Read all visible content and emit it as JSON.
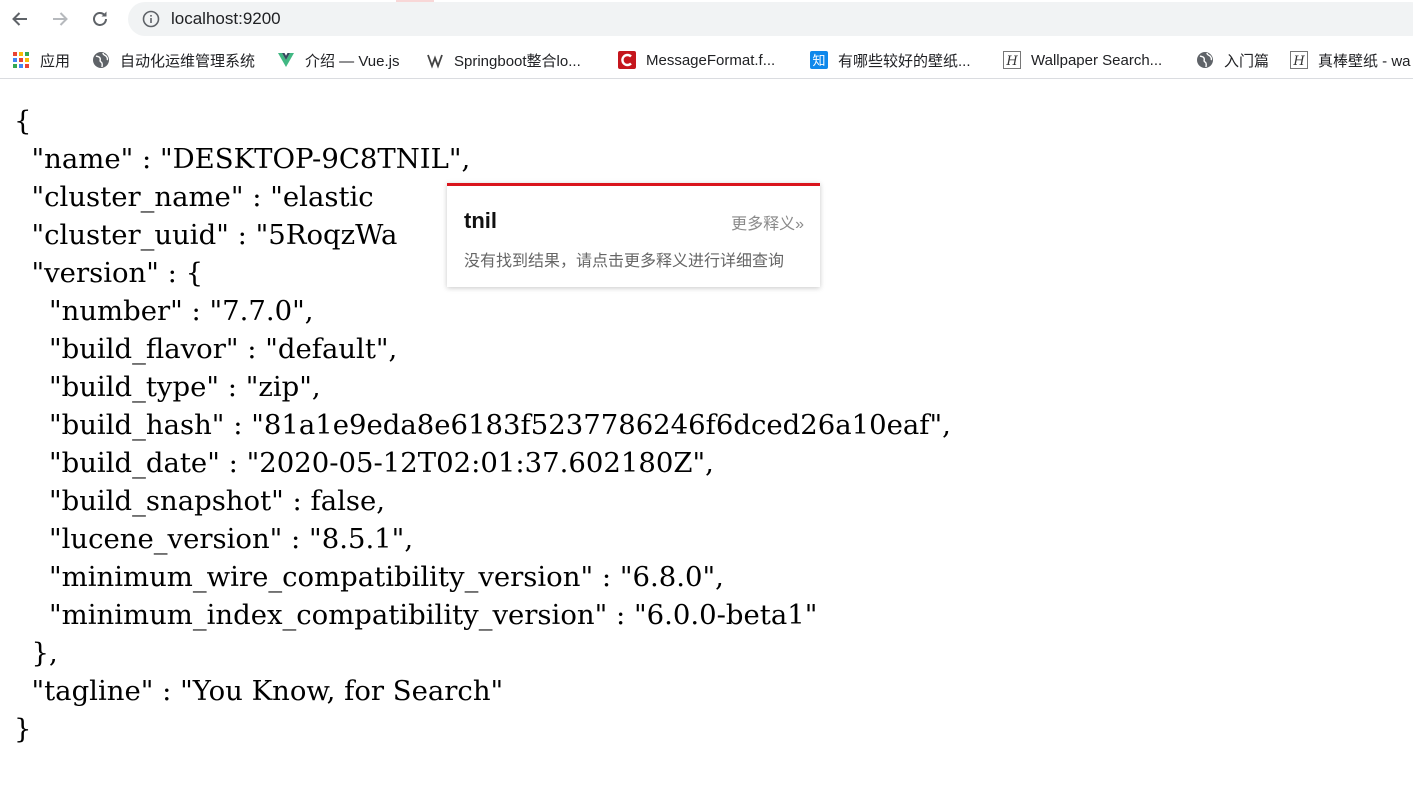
{
  "browser": {
    "url": "localhost:9200",
    "bookmarks": [
      {
        "label": "应用",
        "icon": "apps-grid-icon"
      },
      {
        "label": "自动化运维管理系统",
        "icon": "globe-icon"
      },
      {
        "label": "介绍 — Vue.js",
        "icon": "vue-logo-icon"
      },
      {
        "label": "Springboot整合lo...",
        "icon": "site-logo-icon"
      },
      {
        "label": "MessageFormat.f...",
        "icon": "red-c-logo-icon"
      },
      {
        "label": "有哪些较好的壁纸...",
        "icon": "zhihu-logo-icon"
      },
      {
        "label": "Wallpaper Search...",
        "icon": "wallhaven-logo-icon"
      },
      {
        "label": "入门篇",
        "icon": "globe-icon"
      },
      {
        "label": "真棒壁纸 - wa",
        "icon": "wallhaven-logo-icon"
      }
    ]
  },
  "json_lines": [
    "{",
    "  \"name\" : \"DESKTOP-9C8TNIL\",",
    "  \"cluster_name\" : \"elastic",
    "  \"cluster_uuid\" : \"5RoqzWa",
    "  \"version\" : {",
    "    \"number\" : \"7.7.0\",",
    "    \"build_flavor\" : \"default\",",
    "    \"build_type\" : \"zip\",",
    "    \"build_hash\" : \"81a1e9eda8e6183f5237786246f6dced26a10eaf\",",
    "    \"build_date\" : \"2020-05-12T02:01:37.602180Z\",",
    "    \"build_snapshot\" : false,",
    "    \"lucene_version\" : \"8.5.1\",",
    "    \"minimum_wire_compatibility_version\" : \"6.8.0\",",
    "    \"minimum_index_compatibility_version\" : \"6.0.0-beta1\"",
    "  },",
    "  \"tagline\" : \"You Know, for Search\"",
    "}"
  ],
  "popup": {
    "word": "tnil",
    "more_link": "更多释义»",
    "message": "没有找到结果，请点击更多释义进行详细查询"
  },
  "colors": {
    "popup_accent": "#d9141c",
    "omnibox_bg": "#f1f3f4"
  }
}
